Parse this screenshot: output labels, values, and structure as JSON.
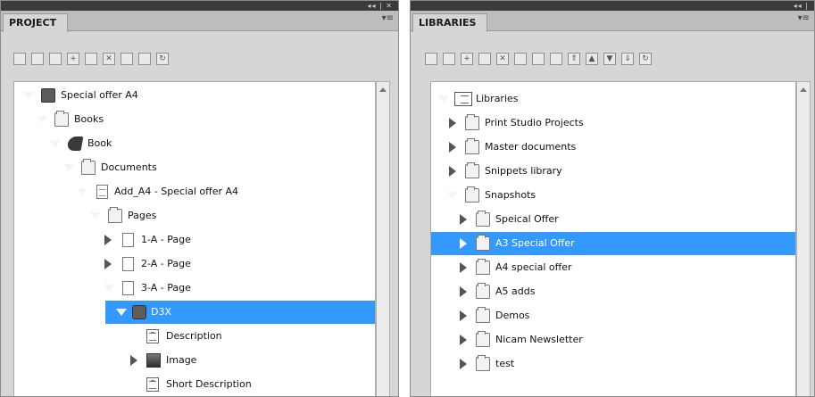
{
  "project": {
    "tab_label": "PROJECT",
    "topbar_glyphs": "◂◂ | ✕",
    "menu_glyph": "▾≡",
    "toolbar_icons": [
      "new-doc-icon",
      "save-icon",
      "properties-icon",
      "add-icon",
      "duplicate-icon",
      "delete-icon",
      "page-icon",
      "preview-icon",
      "refresh-icon"
    ],
    "tree": [
      {
        "label": "Special offer A4",
        "icon": "book-icon",
        "expanded": true
      },
      {
        "label": "Books",
        "icon": "folder-icon",
        "expanded": true
      },
      {
        "label": "Book",
        "icon": "book-icon",
        "expanded": true
      },
      {
        "label": "Documents",
        "icon": "folder-icon",
        "expanded": true
      },
      {
        "label": "Add_A4 - Special offer A4",
        "icon": "document-icon",
        "expanded": true
      },
      {
        "label": "Pages",
        "icon": "folder-icon",
        "expanded": true
      },
      {
        "label": "1-A - Page",
        "icon": "page-icon",
        "expanded": false
      },
      {
        "label": "2-A - Page",
        "icon": "page-icon",
        "expanded": false
      },
      {
        "label": "3-A - Page",
        "icon": "page-icon",
        "expanded": true
      },
      {
        "label": "D3X",
        "icon": "d3x-icon",
        "expanded": true,
        "selected": true
      },
      {
        "label": "Description",
        "icon": "text-field-icon"
      },
      {
        "label": "Image",
        "icon": "image-icon",
        "expanded": false
      },
      {
        "label": "Short Description",
        "icon": "text-field-icon"
      }
    ]
  },
  "libraries": {
    "tab_label": "LIBRARIES",
    "topbar_glyphs": "◂◂ |",
    "menu_glyph": "▾≡",
    "toolbar_icons": [
      "new-doc-icon",
      "save-icon",
      "add-icon",
      "import-icon",
      "delete-icon",
      "move-icon",
      "open-icon",
      "copy-icon",
      "collapse-all-icon",
      "up-icon",
      "down-icon",
      "expand-all-icon",
      "refresh-icon"
    ],
    "tree": [
      {
        "label": "Libraries",
        "icon": "library-icon",
        "expanded": true
      },
      {
        "label": "Print Studio Projects",
        "icon": "folder-icon",
        "expanded": false
      },
      {
        "label": "Master documents",
        "icon": "folder-icon",
        "expanded": false
      },
      {
        "label": "Snippets library",
        "icon": "folder-icon",
        "expanded": false
      },
      {
        "label": "Snapshots",
        "icon": "folder-icon",
        "expanded": true
      },
      {
        "label": "Speical Offer",
        "icon": "folder-icon",
        "expanded": false
      },
      {
        "label": "A3 Special Offer",
        "icon": "folder-icon",
        "expanded": false,
        "selected": true
      },
      {
        "label": "A4 special offer",
        "icon": "folder-icon",
        "expanded": false
      },
      {
        "label": "A5 adds",
        "icon": "folder-icon",
        "expanded": false
      },
      {
        "label": "Demos",
        "icon": "folder-icon",
        "expanded": false
      },
      {
        "label": "Nicam Newsletter",
        "icon": "folder-icon",
        "expanded": false
      },
      {
        "label": "test",
        "icon": "folder-icon",
        "expanded": false
      }
    ]
  },
  "colors": {
    "selection": "#3399ff",
    "panel_bg": "#d6d6d6",
    "titlebar": "#3b3b3b"
  }
}
